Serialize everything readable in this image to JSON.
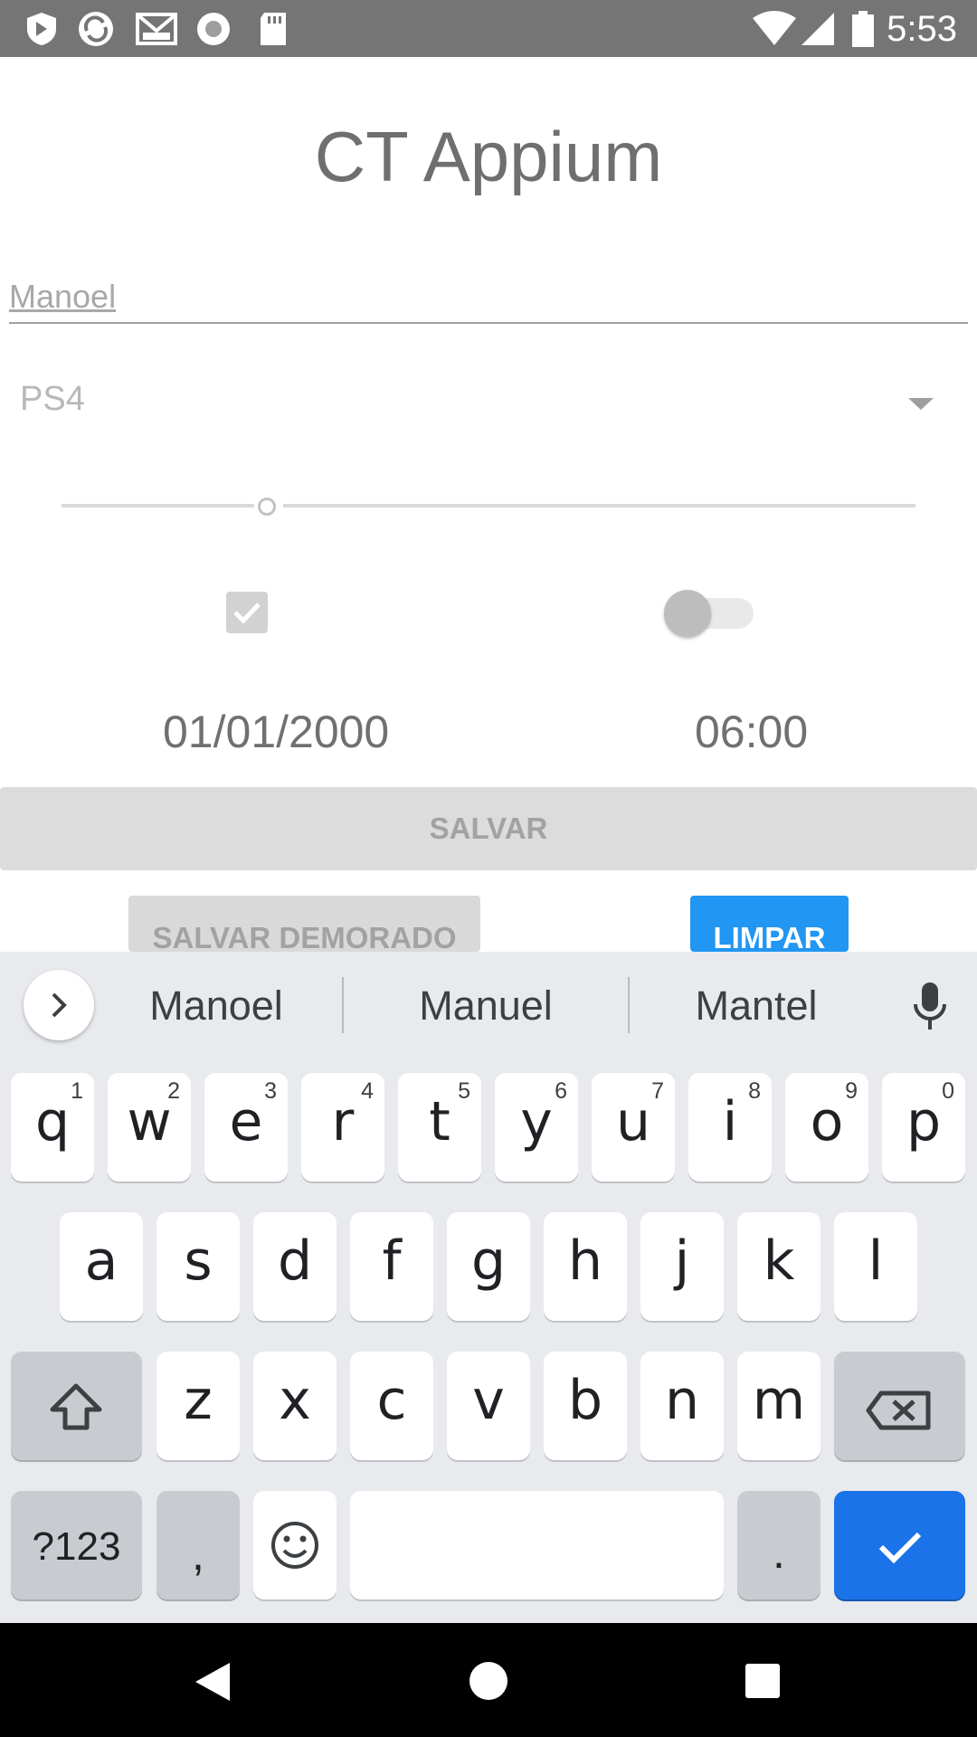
{
  "status_bar": {
    "time": "5:53",
    "left_icons": [
      "shield-icon",
      "sync-icon",
      "gmail-icon",
      "record-icon",
      "sd-card-icon"
    ],
    "right_icons": [
      "wifi-icon",
      "signal-icon",
      "battery-icon"
    ]
  },
  "app": {
    "title": "CT Appium",
    "name_field": {
      "value": "Manoel"
    },
    "console_select": {
      "selected": "PS4"
    },
    "slider": {
      "value_fraction": 0.24
    },
    "checkbox": {
      "checked": true
    },
    "switch": {
      "on": false
    },
    "date": "01/01/2000",
    "time": "06:00",
    "buttons": {
      "save": "SALVAR",
      "save_delayed": "SALVAR DEMORADO",
      "clear": "LIMPAR"
    }
  },
  "keyboard": {
    "suggestions": [
      "Manoel",
      "Manuel",
      "Mantel"
    ],
    "row1": [
      {
        "key": "q",
        "hint": "1"
      },
      {
        "key": "w",
        "hint": "2"
      },
      {
        "key": "e",
        "hint": "3"
      },
      {
        "key": "r",
        "hint": "4"
      },
      {
        "key": "t",
        "hint": "5"
      },
      {
        "key": "y",
        "hint": "6"
      },
      {
        "key": "u",
        "hint": "7"
      },
      {
        "key": "i",
        "hint": "8"
      },
      {
        "key": "o",
        "hint": "9"
      },
      {
        "key": "p",
        "hint": "0"
      }
    ],
    "row2": [
      "a",
      "s",
      "d",
      "f",
      "g",
      "h",
      "j",
      "k",
      "l"
    ],
    "row3": [
      "z",
      "x",
      "c",
      "v",
      "b",
      "n",
      "m"
    ],
    "symbols_key": "?123",
    "comma_key": ",",
    "period_key": ".",
    "accent": "#1a73e8"
  },
  "nav_bar": {
    "icons": [
      "back-icon",
      "home-icon",
      "recents-icon"
    ]
  }
}
